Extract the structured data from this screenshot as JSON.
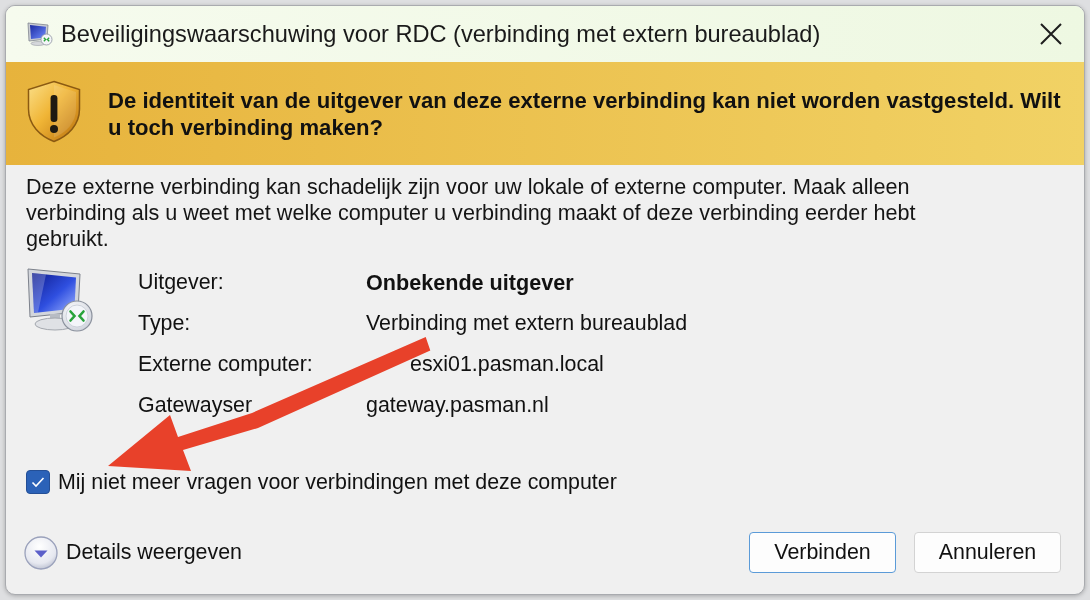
{
  "window": {
    "title": "Beveiligingswaarschuwing voor RDC (verbinding met extern bureaublad)"
  },
  "warning": {
    "message": "De identiteit van de uitgever van deze externe verbinding kan niet worden vastgesteld. Wilt u toch verbinding maken?"
  },
  "description": "Deze externe verbinding kan schadelijk zijn voor uw lokale of externe computer. Maak alleen verbinding als u weet met welke computer u verbinding maakt of deze verbinding eerder hebt gebruikt.",
  "properties": [
    {
      "label": "Uitgever:",
      "value": "Onbekende uitgever",
      "emphasized": true
    },
    {
      "label": "Type:",
      "value": "Verbinding met extern bureaublad",
      "emphasized": false
    },
    {
      "label": "Externe computer:",
      "value": "esxi01.pasman.local",
      "emphasized": false
    },
    {
      "label": "Gatewayser",
      "value": "gateway.pasman.nl",
      "emphasized": false
    }
  ],
  "remember": {
    "label": "Mij niet meer vragen voor verbindingen met deze computer",
    "checked": true
  },
  "details_toggle": {
    "label": "Details weergeven"
  },
  "buttons": [
    {
      "label": "Verbinden",
      "default": true
    },
    {
      "label": "Annuleren",
      "default": false
    }
  ]
}
